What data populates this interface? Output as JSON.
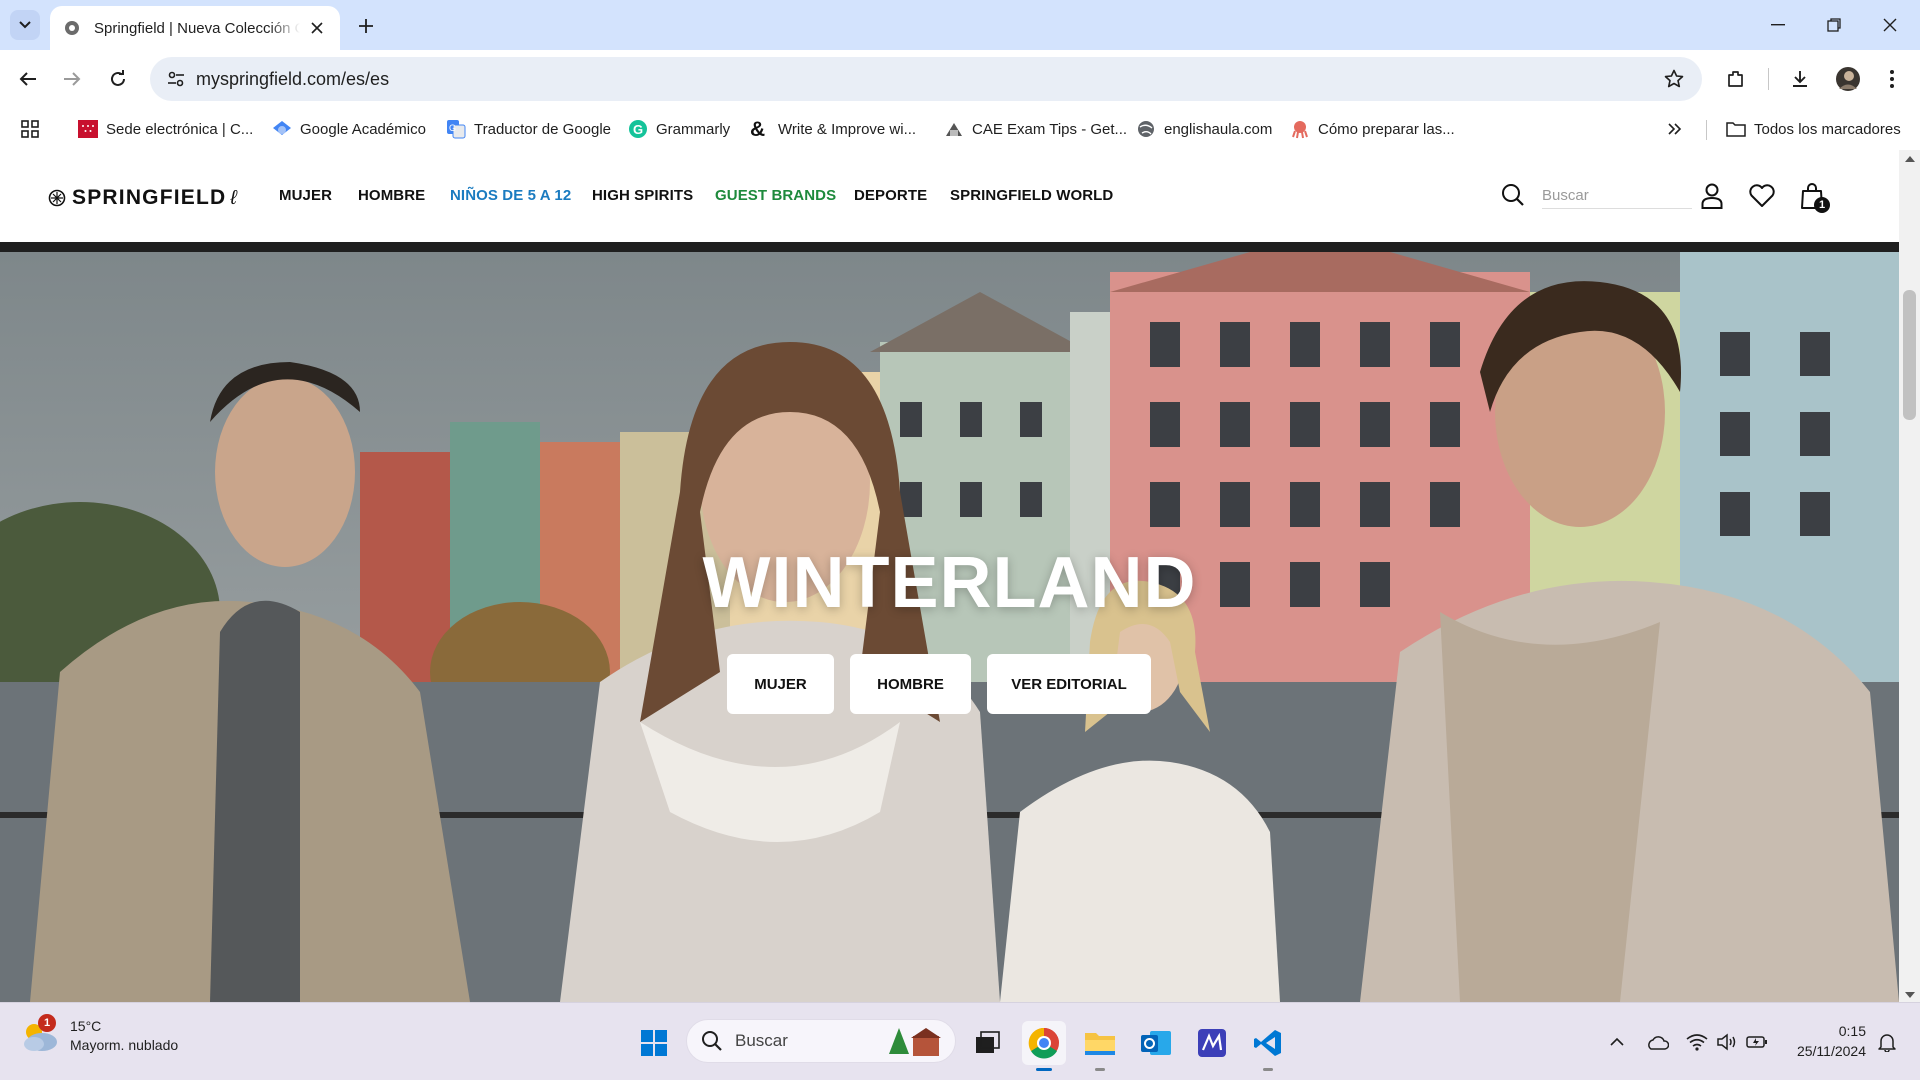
{
  "browser": {
    "tab_title": "Springfield | Nueva Colección Online",
    "url": "myspringfield.com/es/es",
    "bookmarks": [
      {
        "label": "Sede electrónica | C...",
        "icon": "madrid-flag-icon"
      },
      {
        "label": "Google Académico",
        "icon": "scholar-icon"
      },
      {
        "label": "Traductor de Google",
        "icon": "translate-icon"
      },
      {
        "label": "Grammarly",
        "icon": "grammarly-icon"
      },
      {
        "label": "Write & Improve wi...",
        "icon": "ampersand-icon"
      },
      {
        "label": "CAE Exam Tips - Get...",
        "icon": "cae-icon"
      },
      {
        "label": "englishaula.com",
        "icon": "globe-icon"
      },
      {
        "label": "Cómo preparar las...",
        "icon": "octopus-icon"
      }
    ],
    "all_bookmarks_label": "Todos los marcadores"
  },
  "site": {
    "logo": "SPRINGFIELD",
    "nav": [
      {
        "label": "MUJER",
        "color": "#111111"
      },
      {
        "label": "HOMBRE",
        "color": "#111111"
      },
      {
        "label": "NIÑOS DE 5 A 12",
        "color": "#1a7bc0"
      },
      {
        "label": "HIGH SPIRITS",
        "color": "#111111"
      },
      {
        "label": "GUEST BRANDS",
        "color": "#1e8a3c"
      },
      {
        "label": "DEPORTE",
        "color": "#111111"
      },
      {
        "label": "SPRINGFIELD WORLD",
        "color": "#111111"
      }
    ],
    "search_placeholder": "Buscar",
    "cart_count": "1"
  },
  "hero": {
    "title": "WINTERLAND",
    "buttons": [
      "MUJER",
      "HOMBRE",
      "VER EDITORIAL"
    ]
  },
  "taskbar": {
    "weather_temp": "15°C",
    "weather_desc": "Mayorm. nublado",
    "weather_badge": "1",
    "search_label": "Buscar",
    "time": "0:15",
    "date": "25/11/2024"
  }
}
